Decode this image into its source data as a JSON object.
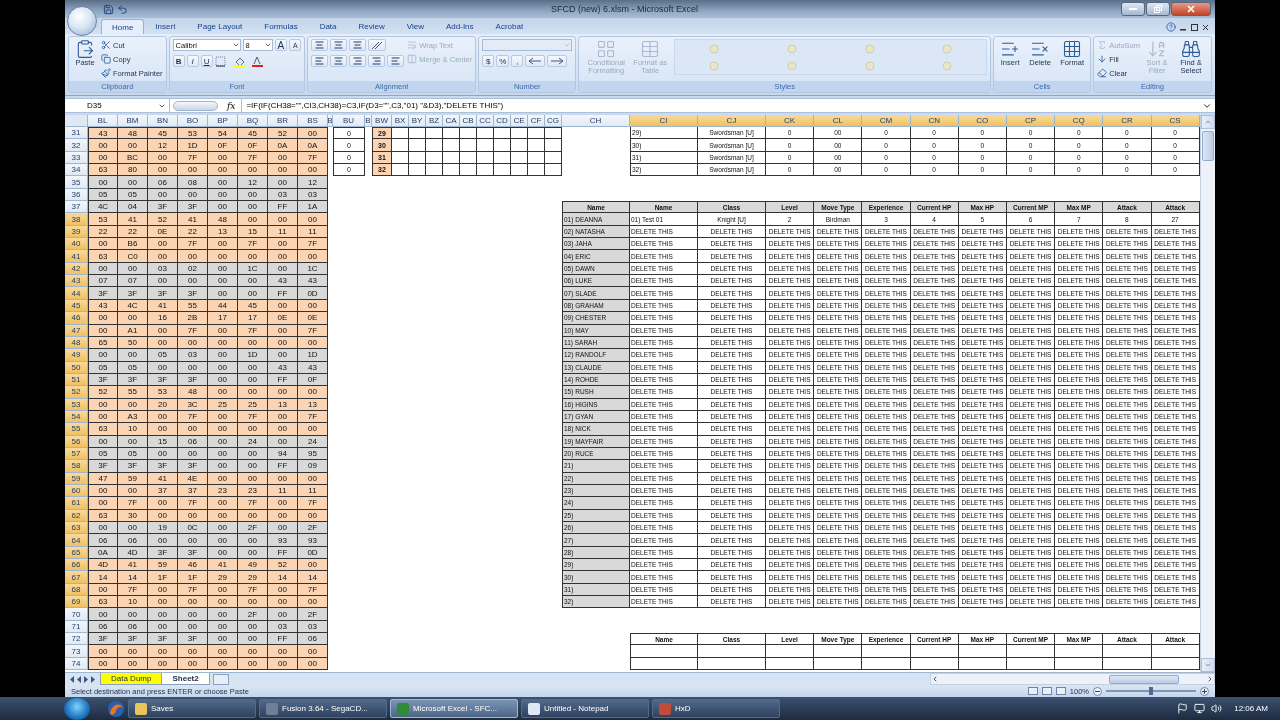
{
  "window": {
    "title": "SFCD (new) 6.xlsm - Microsoft Excel"
  },
  "ribbon_tabs": [
    {
      "label": "Home",
      "selected": true
    },
    {
      "label": "Insert",
      "selected": false
    },
    {
      "label": "Page Layout",
      "selected": false
    },
    {
      "label": "Formulas",
      "selected": false
    },
    {
      "label": "Data",
      "selected": false
    },
    {
      "label": "Review",
      "selected": false
    },
    {
      "label": "View",
      "selected": false
    },
    {
      "label": "Add-Ins",
      "selected": false
    },
    {
      "label": "Acrobat",
      "selected": false
    }
  ],
  "ribbon_groups": [
    {
      "label": "Clipboard",
      "items": [
        {
          "kind": "large",
          "label": "Paste",
          "disabled": false
        },
        {
          "kind": "stack",
          "entries": [
            {
              "label": "Cut",
              "disabled": false
            },
            {
              "label": "Copy",
              "disabled": false
            },
            {
              "label": "Format Painter",
              "disabled": false
            }
          ]
        }
      ]
    },
    {
      "label": "Font",
      "items": [
        {
          "kind": "font",
          "fields": [
            "Calibri",
            "8"
          ],
          "size_buttons": [
            "A",
            "A"
          ],
          "style_buttons": [
            "B",
            "I",
            "U"
          ]
        }
      ]
    },
    {
      "label": "Alignment",
      "items": [
        {
          "kind": "align"
        },
        {
          "kind": "stack",
          "entries": [
            {
              "label": "Wrap Text",
              "disabled": true
            },
            {
              "label": "Merge & Center",
              "disabled": true
            }
          ]
        }
      ]
    },
    {
      "label": "Number",
      "items": [
        {
          "kind": "number",
          "buttons": [
            "$",
            "%",
            ","
          ]
        }
      ]
    },
    {
      "label": "Styles",
      "items": [
        {
          "kind": "large",
          "label": "Conditional Formatting",
          "disabled": true
        },
        {
          "kind": "large",
          "label": "Format as Table",
          "disabled": true
        },
        {
          "kind": "gallery"
        }
      ]
    },
    {
      "label": "Cells",
      "items": [
        {
          "kind": "large",
          "label": "Insert",
          "disabled": false
        },
        {
          "kind": "large",
          "label": "Delete",
          "disabled": false
        },
        {
          "kind": "large",
          "label": "Format",
          "disabled": false
        }
      ]
    },
    {
      "label": "Editing",
      "items": [
        {
          "kind": "stack",
          "entries": [
            {
              "label": "AutoSum",
              "disabled": true
            },
            {
              "label": "Fill",
              "disabled": false
            },
            {
              "label": "Clear",
              "disabled": false
            }
          ]
        },
        {
          "kind": "large",
          "label": "Sort & Filter",
          "disabled": true
        },
        {
          "kind": "large",
          "label": "Find & Select",
          "disabled": false
        }
      ]
    }
  ],
  "formula_bar": {
    "name_box": "D35",
    "function_label": "fx",
    "formula": "=IF(IF(CH38=\"\",CI3,CH38)=C3,IF(D3=\"\",C3,\"01) \"&D3),\"DELETE THIS\")"
  },
  "sheet": {
    "columns": [
      {
        "label": "BL",
        "selected": false
      },
      {
        "label": "BM",
        "selected": false
      },
      {
        "label": "BN",
        "selected": false
      },
      {
        "label": "BO",
        "selected": false
      },
      {
        "label": "BP",
        "selected": false
      },
      {
        "label": "BQ",
        "selected": false
      },
      {
        "label": "BR",
        "selected": false
      },
      {
        "label": "BS",
        "selected": false
      },
      {
        "label": "B",
        "selected": false
      },
      {
        "label": "BU",
        "selected": false
      },
      {
        "label": "B",
        "selected": false
      },
      {
        "label": "BW",
        "selected": false
      },
      {
        "label": "BX",
        "selected": false
      },
      {
        "label": "BY",
        "selected": false
      },
      {
        "label": "BZ",
        "selected": false
      },
      {
        "label": "CA",
        "selected": false
      },
      {
        "label": "CB",
        "selected": false
      },
      {
        "label": "CC",
        "selected": false
      },
      {
        "label": "CD",
        "selected": false
      },
      {
        "label": "CE",
        "selected": false
      },
      {
        "label": "CF",
        "selected": false
      },
      {
        "label": "CG",
        "selected": false
      },
      {
        "label": "CH",
        "selected": false
      },
      {
        "label": "CI",
        "selected": true
      },
      {
        "label": "CJ",
        "selected": true
      },
      {
        "label": "CK",
        "selected": true
      },
      {
        "label": "CL",
        "selected": true
      },
      {
        "label": "CM",
        "selected": true
      },
      {
        "label": "CN",
        "selected": true
      },
      {
        "label": "CO",
        "selected": true
      },
      {
        "label": "CP",
        "selected": true
      },
      {
        "label": "CQ",
        "selected": true
      },
      {
        "label": "CR",
        "selected": true
      },
      {
        "label": "CS",
        "selected": true
      }
    ],
    "rows": [
      {
        "number": "31",
        "selected": false
      },
      {
        "number": "32",
        "selected": false
      },
      {
        "number": "33",
        "selected": false
      },
      {
        "number": "34",
        "selected": false
      },
      {
        "number": "35",
        "selected": false
      },
      {
        "number": "36",
        "selected": false
      },
      {
        "number": "37",
        "selected": false
      },
      {
        "number": "38",
        "selected": true
      },
      {
        "number": "39",
        "selected": true
      },
      {
        "number": "40",
        "selected": true
      },
      {
        "number": "41",
        "selected": true
      },
      {
        "number": "42",
        "selected": true
      },
      {
        "number": "43",
        "selected": true
      },
      {
        "number": "44",
        "selected": true
      },
      {
        "number": "45",
        "selected": true
      },
      {
        "number": "46",
        "selected": true
      },
      {
        "number": "47",
        "selected": true
      },
      {
        "number": "48",
        "selected": true
      },
      {
        "number": "49",
        "selected": true
      },
      {
        "number": "50",
        "selected": true
      },
      {
        "number": "51",
        "selected": true
      },
      {
        "number": "52",
        "selected": true
      },
      {
        "number": "53",
        "selected": true
      },
      {
        "number": "54",
        "selected": true
      },
      {
        "number": "55",
        "selected": true
      },
      {
        "number": "56",
        "selected": true
      },
      {
        "number": "57",
        "selected": true
      },
      {
        "number": "58",
        "selected": true
      },
      {
        "number": "59",
        "selected": true
      },
      {
        "number": "60",
        "selected": true
      },
      {
        "number": "61",
        "selected": true
      },
      {
        "number": "62",
        "selected": true
      },
      {
        "number": "63",
        "selected": true
      },
      {
        "number": "64",
        "selected": true
      },
      {
        "number": "65",
        "selected": true
      },
      {
        "number": "66",
        "selected": true
      },
      {
        "number": "67",
        "selected": true
      },
      {
        "number": "68",
        "selected": true
      },
      {
        "number": "69",
        "selected": true
      },
      {
        "number": "70",
        "selected": false
      },
      {
        "number": "71",
        "selected": false
      },
      {
        "number": "72",
        "selected": false
      },
      {
        "number": "73",
        "selected": false
      },
      {
        "number": "74",
        "selected": false
      }
    ]
  },
  "hex_block": {
    "rows": [
      {
        "color": "#fbd4b4",
        "values": [
          "43",
          "48",
          "45",
          "53",
          "54",
          "45",
          "52",
          "00"
        ]
      },
      {
        "color": "#fbd4b4",
        "values": [
          "00",
          "00",
          "12",
          "1D",
          "0F",
          "0F",
          "0A",
          "0A"
        ]
      },
      {
        "color": "#fbd4b4",
        "values": [
          "00",
          "BC",
          "00",
          "7F",
          "00",
          "7F",
          "00",
          "7F"
        ]
      },
      {
        "color": "#fbd4b4",
        "values": [
          "63",
          "80",
          "00",
          "00",
          "00",
          "00",
          "00",
          "00"
        ]
      },
      {
        "color": "#d9d9d9",
        "values": [
          "00",
          "00",
          "06",
          "08",
          "00",
          "12",
          "00",
          "12"
        ]
      },
      {
        "color": "#d9d9d9",
        "values": [
          "05",
          "05",
          "00",
          "00",
          "00",
          "00",
          "03",
          "03"
        ]
      },
      {
        "color": "#d9d9d9",
        "values": [
          "4C",
          "04",
          "3F",
          "3F",
          "00",
          "00",
          "FF",
          "1A"
        ]
      },
      {
        "color": "#fbd4b4",
        "values": [
          "53",
          "41",
          "52",
          "41",
          "48",
          "00",
          "00",
          "00"
        ]
      },
      {
        "color": "#fbd4b4",
        "values": [
          "22",
          "22",
          "0E",
          "22",
          "13",
          "15",
          "11",
          "11"
        ]
      },
      {
        "color": "#fbd4b4",
        "values": [
          "00",
          "B6",
          "00",
          "7F",
          "00",
          "7F",
          "00",
          "7F"
        ]
      },
      {
        "color": "#fbd4b4",
        "values": [
          "63",
          "C0",
          "00",
          "00",
          "00",
          "00",
          "00",
          "00"
        ]
      },
      {
        "color": "#d9d9d9",
        "values": [
          "00",
          "00",
          "03",
          "02",
          "00",
          "1C",
          "00",
          "1C"
        ]
      },
      {
        "color": "#d9d9d9",
        "values": [
          "07",
          "07",
          "00",
          "00",
          "00",
          "00",
          "43",
          "43"
        ]
      },
      {
        "color": "#d9d9d9",
        "values": [
          "3F",
          "3F",
          "3F",
          "3F",
          "00",
          "00",
          "FF",
          "0D"
        ]
      },
      {
        "color": "#fbd4b4",
        "values": [
          "43",
          "4C",
          "41",
          "55",
          "44",
          "45",
          "00",
          "00"
        ]
      },
      {
        "color": "#fbd4b4",
        "values": [
          "00",
          "00",
          "16",
          "2B",
          "17",
          "17",
          "0E",
          "0E"
        ]
      },
      {
        "color": "#fbd4b4",
        "values": [
          "00",
          "A1",
          "00",
          "7F",
          "00",
          "7F",
          "00",
          "7F"
        ]
      },
      {
        "color": "#fbd4b4",
        "values": [
          "65",
          "50",
          "00",
          "00",
          "00",
          "00",
          "00",
          "00"
        ]
      },
      {
        "color": "#d9d9d9",
        "values": [
          "00",
          "00",
          "05",
          "03",
          "00",
          "1D",
          "00",
          "1D"
        ]
      },
      {
        "color": "#d9d9d9",
        "values": [
          "05",
          "05",
          "00",
          "00",
          "00",
          "00",
          "43",
          "43"
        ]
      },
      {
        "color": "#d9d9d9",
        "values": [
          "3F",
          "3F",
          "3F",
          "3F",
          "00",
          "00",
          "FF",
          "0F"
        ]
      },
      {
        "color": "#fbd4b4",
        "values": [
          "52",
          "55",
          "53",
          "48",
          "00",
          "00",
          "00",
          "00"
        ]
      },
      {
        "color": "#fbd4b4",
        "values": [
          "00",
          "00",
          "20",
          "3C",
          "25",
          "25",
          "13",
          "13"
        ]
      },
      {
        "color": "#fbd4b4",
        "values": [
          "00",
          "A3",
          "00",
          "7F",
          "00",
          "7F",
          "00",
          "7F"
        ]
      },
      {
        "color": "#fbd4b4",
        "values": [
          "63",
          "10",
          "00",
          "00",
          "00",
          "00",
          "00",
          "00"
        ]
      },
      {
        "color": "#d9d9d9",
        "values": [
          "00",
          "00",
          "15",
          "06",
          "00",
          "24",
          "00",
          "24"
        ]
      },
      {
        "color": "#d9d9d9",
        "values": [
          "05",
          "05",
          "00",
          "00",
          "00",
          "00",
          "94",
          "95"
        ]
      },
      {
        "color": "#d9d9d9",
        "values": [
          "3F",
          "3F",
          "3F",
          "3F",
          "00",
          "00",
          "FF",
          "09"
        ]
      },
      {
        "color": "#fbd4b4",
        "values": [
          "47",
          "59",
          "41",
          "4E",
          "00",
          "00",
          "00",
          "00"
        ]
      },
      {
        "color": "#fbd4b4",
        "values": [
          "00",
          "00",
          "37",
          "37",
          "23",
          "23",
          "11",
          "11"
        ]
      },
      {
        "color": "#fbd4b4",
        "values": [
          "00",
          "7F",
          "00",
          "7F",
          "00",
          "7F",
          "00",
          "7F"
        ]
      },
      {
        "color": "#fbd4b4",
        "values": [
          "63",
          "30",
          "00",
          "00",
          "00",
          "00",
          "00",
          "00"
        ]
      },
      {
        "color": "#d9d9d9",
        "values": [
          "00",
          "00",
          "19",
          "0C",
          "00",
          "2F",
          "00",
          "2F"
        ]
      },
      {
        "color": "#d9d9d9",
        "values": [
          "06",
          "06",
          "00",
          "00",
          "00",
          "00",
          "93",
          "93"
        ]
      },
      {
        "color": "#d9d9d9",
        "values": [
          "0A",
          "4D",
          "3F",
          "3F",
          "00",
          "00",
          "FF",
          "0D"
        ]
      },
      {
        "color": "#fbd4b4",
        "values": [
          "4D",
          "41",
          "59",
          "46",
          "41",
          "49",
          "52",
          "00"
        ]
      },
      {
        "color": "#fbd4b4",
        "values": [
          "14",
          "14",
          "1F",
          "1F",
          "29",
          "29",
          "14",
          "14"
        ]
      },
      {
        "color": "#fbd4b4",
        "values": [
          "00",
          "7F",
          "00",
          "7F",
          "00",
          "7F",
          "00",
          "7F"
        ]
      },
      {
        "color": "#fbd4b4",
        "values": [
          "63",
          "10",
          "00",
          "00",
          "00",
          "00",
          "00",
          "00"
        ]
      },
      {
        "color": "#d9d9d9",
        "values": [
          "00",
          "00",
          "00",
          "00",
          "00",
          "2F",
          "00",
          "2F"
        ]
      },
      {
        "color": "#d9d9d9",
        "values": [
          "06",
          "06",
          "00",
          "00",
          "00",
          "00",
          "03",
          "03"
        ]
      },
      {
        "color": "#d9d9d9",
        "values": [
          "3F",
          "3F",
          "3F",
          "3F",
          "00",
          "00",
          "FF",
          "06"
        ]
      },
      {
        "color": "#fbd4b4",
        "values": [
          "00",
          "00",
          "00",
          "00",
          "00",
          "00",
          "00",
          "00"
        ]
      },
      {
        "color": "#fbd4b4",
        "values": [
          "00",
          "00",
          "00",
          "00",
          "00",
          "00",
          "00",
          "00"
        ]
      }
    ]
  },
  "side_block": {
    "rows": [
      {
        "bu": "0",
        "bw": "29"
      },
      {
        "bu": "0",
        "bw": "30"
      },
      {
        "bu": "0",
        "bw": "31"
      },
      {
        "bu": "0",
        "bw": "32"
      }
    ]
  },
  "upper_table": {
    "rows": [
      [
        "29)",
        "Swordsman [U]",
        "0",
        "00",
        "0",
        "0",
        "0",
        "0",
        "0",
        "0",
        "0"
      ],
      [
        "30)",
        "Swordsman [U]",
        "0",
        "00",
        "0",
        "0",
        "0",
        "0",
        "0",
        "0",
        "0"
      ],
      [
        "31)",
        "Swordsman [U]",
        "0",
        "00",
        "0",
        "0",
        "0",
        "0",
        "0",
        "0",
        "0"
      ],
      [
        "32)",
        "Swordsman [U]",
        "0",
        "00",
        "0",
        "0",
        "0",
        "0",
        "0",
        "0",
        "0"
      ]
    ]
  },
  "roster_table": {
    "columns": [
      "Name",
      "Name",
      "Class",
      "Level",
      "Move Type",
      "Experience",
      "Current HP",
      "Max HP",
      "Current MP",
      "Max MP",
      "Attack",
      "Attack"
    ],
    "rows": [
      {
        "cells": [
          "01) DEANNA",
          "01) Test 01",
          "Knight [U]",
          "2",
          "Birdman",
          "3",
          "4",
          "5",
          "6",
          "7",
          "8",
          "27"
        ]
      },
      {
        "cells": [
          "02) NATASHA",
          "DELETE THIS",
          "DELETE THIS",
          "DELETE THIS",
          "DELETE THIS",
          "DELETE THIS",
          "DELETE THIS",
          "DELETE THIS",
          "DELETE THIS",
          "DELETE THIS",
          "DELETE THIS",
          "DELETE THIS"
        ]
      },
      {
        "cells": [
          "03) JAHA",
          "DELETE THIS",
          "DELETE THIS",
          "DELETE THIS",
          "DELETE THIS",
          "DELETE THIS",
          "DELETE THIS",
          "DELETE THIS",
          "DELETE THIS",
          "DELETE THIS",
          "DELETE THIS",
          "DELETE THIS"
        ]
      },
      {
        "cells": [
          "04) ERIC",
          "DELETE THIS",
          "DELETE THIS",
          "DELETE THIS",
          "DELETE THIS",
          "DELETE THIS",
          "DELETE THIS",
          "DELETE THIS",
          "DELETE THIS",
          "DELETE THIS",
          "DELETE THIS",
          "DELETE THIS"
        ]
      },
      {
        "cells": [
          "05) DAWN",
          "DELETE THIS",
          "DELETE THIS",
          "DELETE THIS",
          "DELETE THIS",
          "DELETE THIS",
          "DELETE THIS",
          "DELETE THIS",
          "DELETE THIS",
          "DELETE THIS",
          "DELETE THIS",
          "DELETE THIS"
        ]
      },
      {
        "cells": [
          "06) LUKE",
          "DELETE THIS",
          "DELETE THIS",
          "DELETE THIS",
          "DELETE THIS",
          "DELETE THIS",
          "DELETE THIS",
          "DELETE THIS",
          "DELETE THIS",
          "DELETE THIS",
          "DELETE THIS",
          "DELETE THIS"
        ]
      },
      {
        "cells": [
          "07) SLADE",
          "DELETE THIS",
          "DELETE THIS",
          "DELETE THIS",
          "DELETE THIS",
          "DELETE THIS",
          "DELETE THIS",
          "DELETE THIS",
          "DELETE THIS",
          "DELETE THIS",
          "DELETE THIS",
          "DELETE THIS"
        ]
      },
      {
        "cells": [
          "08) GRAHAM",
          "DELETE THIS",
          "DELETE THIS",
          "DELETE THIS",
          "DELETE THIS",
          "DELETE THIS",
          "DELETE THIS",
          "DELETE THIS",
          "DELETE THIS",
          "DELETE THIS",
          "DELETE THIS",
          "DELETE THIS"
        ]
      },
      {
        "cells": [
          "09) CHESTER",
          "DELETE THIS",
          "DELETE THIS",
          "DELETE THIS",
          "DELETE THIS",
          "DELETE THIS",
          "DELETE THIS",
          "DELETE THIS",
          "DELETE THIS",
          "DELETE THIS",
          "DELETE THIS",
          "DELETE THIS"
        ]
      },
      {
        "cells": [
          "10) MAY",
          "DELETE THIS",
          "DELETE THIS",
          "DELETE THIS",
          "DELETE THIS",
          "DELETE THIS",
          "DELETE THIS",
          "DELETE THIS",
          "DELETE THIS",
          "DELETE THIS",
          "DELETE THIS",
          "DELETE THIS"
        ]
      },
      {
        "cells": [
          "11) SARAH",
          "DELETE THIS",
          "DELETE THIS",
          "DELETE THIS",
          "DELETE THIS",
          "DELETE THIS",
          "DELETE THIS",
          "DELETE THIS",
          "DELETE THIS",
          "DELETE THIS",
          "DELETE THIS",
          "DELETE THIS"
        ]
      },
      {
        "cells": [
          "12) RANDOLF",
          "DELETE THIS",
          "DELETE THIS",
          "DELETE THIS",
          "DELETE THIS",
          "DELETE THIS",
          "DELETE THIS",
          "DELETE THIS",
          "DELETE THIS",
          "DELETE THIS",
          "DELETE THIS",
          "DELETE THIS"
        ]
      },
      {
        "cells": [
          "13) CLAUDE",
          "DELETE THIS",
          "DELETE THIS",
          "DELETE THIS",
          "DELETE THIS",
          "DELETE THIS",
          "DELETE THIS",
          "DELETE THIS",
          "DELETE THIS",
          "DELETE THIS",
          "DELETE THIS",
          "DELETE THIS"
        ]
      },
      {
        "cells": [
          "14) ROHDE",
          "DELETE THIS",
          "DELETE THIS",
          "DELETE THIS",
          "DELETE THIS",
          "DELETE THIS",
          "DELETE THIS",
          "DELETE THIS",
          "DELETE THIS",
          "DELETE THIS",
          "DELETE THIS",
          "DELETE THIS"
        ]
      },
      {
        "cells": [
          "15) RUSH",
          "DELETE THIS",
          "DELETE THIS",
          "DELETE THIS",
          "DELETE THIS",
          "DELETE THIS",
          "DELETE THIS",
          "DELETE THIS",
          "DELETE THIS",
          "DELETE THIS",
          "DELETE THIS",
          "DELETE THIS"
        ]
      },
      {
        "cells": [
          "16) HIGINS",
          "DELETE THIS",
          "DELETE THIS",
          "DELETE THIS",
          "DELETE THIS",
          "DELETE THIS",
          "DELETE THIS",
          "DELETE THIS",
          "DELETE THIS",
          "DELETE THIS",
          "DELETE THIS",
          "DELETE THIS"
        ]
      },
      {
        "cells": [
          "17) GYAN",
          "DELETE THIS",
          "DELETE THIS",
          "DELETE THIS",
          "DELETE THIS",
          "DELETE THIS",
          "DELETE THIS",
          "DELETE THIS",
          "DELETE THIS",
          "DELETE THIS",
          "DELETE THIS",
          "DELETE THIS"
        ]
      },
      {
        "cells": [
          "18) NICK",
          "DELETE THIS",
          "DELETE THIS",
          "DELETE THIS",
          "DELETE THIS",
          "DELETE THIS",
          "DELETE THIS",
          "DELETE THIS",
          "DELETE THIS",
          "DELETE THIS",
          "DELETE THIS",
          "DELETE THIS"
        ]
      },
      {
        "cells": [
          "19) MAYFAIR",
          "DELETE THIS",
          "DELETE THIS",
          "DELETE THIS",
          "DELETE THIS",
          "DELETE THIS",
          "DELETE THIS",
          "DELETE THIS",
          "DELETE THIS",
          "DELETE THIS",
          "DELETE THIS",
          "DELETE THIS"
        ]
      },
      {
        "cells": [
          "20) RUCE",
          "DELETE THIS",
          "DELETE THIS",
          "DELETE THIS",
          "DELETE THIS",
          "DELETE THIS",
          "DELETE THIS",
          "DELETE THIS",
          "DELETE THIS",
          "DELETE THIS",
          "DELETE THIS",
          "DELETE THIS"
        ]
      },
      {
        "cells": [
          "21)",
          "DELETE THIS",
          "DELETE THIS",
          "DELETE THIS",
          "DELETE THIS",
          "DELETE THIS",
          "DELETE THIS",
          "DELETE THIS",
          "DELETE THIS",
          "DELETE THIS",
          "DELETE THIS",
          "DELETE THIS"
        ]
      },
      {
        "cells": [
          "22)",
          "DELETE THIS",
          "DELETE THIS",
          "DELETE THIS",
          "DELETE THIS",
          "DELETE THIS",
          "DELETE THIS",
          "DELETE THIS",
          "DELETE THIS",
          "DELETE THIS",
          "DELETE THIS",
          "DELETE THIS"
        ]
      },
      {
        "cells": [
          "23)",
          "DELETE THIS",
          "DELETE THIS",
          "DELETE THIS",
          "DELETE THIS",
          "DELETE THIS",
          "DELETE THIS",
          "DELETE THIS",
          "DELETE THIS",
          "DELETE THIS",
          "DELETE THIS",
          "DELETE THIS"
        ]
      },
      {
        "cells": [
          "24)",
          "DELETE THIS",
          "DELETE THIS",
          "DELETE THIS",
          "DELETE THIS",
          "DELETE THIS",
          "DELETE THIS",
          "DELETE THIS",
          "DELETE THIS",
          "DELETE THIS",
          "DELETE THIS",
          "DELETE THIS"
        ]
      },
      {
        "cells": [
          "25)",
          "DELETE THIS",
          "DELETE THIS",
          "DELETE THIS",
          "DELETE THIS",
          "DELETE THIS",
          "DELETE THIS",
          "DELETE THIS",
          "DELETE THIS",
          "DELETE THIS",
          "DELETE THIS",
          "DELETE THIS"
        ]
      },
      {
        "cells": [
          "26)",
          "DELETE THIS",
          "DELETE THIS",
          "DELETE THIS",
          "DELETE THIS",
          "DELETE THIS",
          "DELETE THIS",
          "DELETE THIS",
          "DELETE THIS",
          "DELETE THIS",
          "DELETE THIS",
          "DELETE THIS"
        ]
      },
      {
        "cells": [
          "27)",
          "DELETE THIS",
          "DELETE THIS",
          "DELETE THIS",
          "DELETE THIS",
          "DELETE THIS",
          "DELETE THIS",
          "DELETE THIS",
          "DELETE THIS",
          "DELETE THIS",
          "DELETE THIS",
          "DELETE THIS"
        ]
      },
      {
        "cells": [
          "28)",
          "DELETE THIS",
          "DELETE THIS",
          "DELETE THIS",
          "DELETE THIS",
          "DELETE THIS",
          "DELETE THIS",
          "DELETE THIS",
          "DELETE THIS",
          "DELETE THIS",
          "DELETE THIS",
          "DELETE THIS"
        ]
      },
      {
        "cells": [
          "29)",
          "DELETE THIS",
          "DELETE THIS",
          "DELETE THIS",
          "DELETE THIS",
          "DELETE THIS",
          "DELETE THIS",
          "DELETE THIS",
          "DELETE THIS",
          "DELETE THIS",
          "DELETE THIS",
          "DELETE THIS"
        ]
      },
      {
        "cells": [
          "30)",
          "DELETE THIS",
          "DELETE THIS",
          "DELETE THIS",
          "DELETE THIS",
          "DELETE THIS",
          "DELETE THIS",
          "DELETE THIS",
          "DELETE THIS",
          "DELETE THIS",
          "DELETE THIS",
          "DELETE THIS"
        ]
      },
      {
        "cells": [
          "31)",
          "DELETE THIS",
          "DELETE THIS",
          "DELETE THIS",
          "DELETE THIS",
          "DELETE THIS",
          "DELETE THIS",
          "DELETE THIS",
          "DELETE THIS",
          "DELETE THIS",
          "DELETE THIS",
          "DELETE THIS"
        ]
      },
      {
        "cells": [
          "32)",
          "DELETE THIS",
          "DELETE THIS",
          "DELETE THIS",
          "DELETE THIS",
          "DELETE THIS",
          "DELETE THIS",
          "DELETE THIS",
          "DELETE THIS",
          "DELETE THIS",
          "DELETE THIS",
          "DELETE THIS"
        ]
      }
    ]
  },
  "lower_table": {
    "columns": [
      "Name",
      "Class",
      "Level",
      "Move Type",
      "Experience",
      "Current HP",
      "Max HP",
      "Current MP",
      "Max MP",
      "Attack",
      "Attack"
    ]
  },
  "sheet_tabs": [
    {
      "label": "Data Dump",
      "selected": false,
      "color": "#ffff00"
    },
    {
      "label": "Sheet2",
      "selected": true,
      "color": "#ffffff"
    }
  ],
  "status_bar": {
    "message": "Select destination and press ENTER or choose Paste",
    "zoom": "100%",
    "zoom_slider": {
      "level": 0.5
    }
  },
  "taskbar": {
    "items": [
      {
        "label": "Saves",
        "selected": false
      },
      {
        "label": "Fusion 3.64 - SegaCD...",
        "selected": false
      },
      {
        "label": "Microsoft Excel - SFC...",
        "selected": true
      },
      {
        "label": "Untitled - Notepad",
        "selected": false
      },
      {
        "label": "HxD",
        "selected": false
      }
    ],
    "clock": "12:06 AM"
  }
}
